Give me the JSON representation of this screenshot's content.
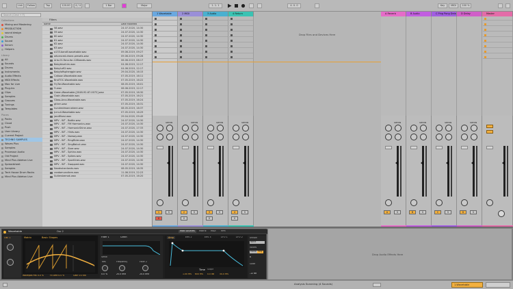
{
  "transport": {
    "link_label": "Link",
    "follow_label": "Follow",
    "tap_label": "Tap",
    "tempo": "120.00",
    "time_sig": "4 / 4",
    "bar_label": "1 Bar",
    "key_label": "Major",
    "position": "1. 1. 1",
    "loop_len": "4. 0. 0",
    "cpu": "CPU",
    "key_sel": "Key",
    "midi_sel": "MIDI",
    "zoom": "100 %"
  },
  "browser": {
    "search_placeholder": "Search (Cmd + F)",
    "places_heading": "Collections",
    "places": [
      {
        "label": "Mixing and Mastering",
        "color": "#e04b3a"
      },
      {
        "label": "PRODUCTION",
        "color": "#f08c28"
      },
      {
        "label": "sound design",
        "color": "#e2c935"
      },
      {
        "label": "Drums",
        "color": "#4cb34c"
      },
      {
        "label": "Sound",
        "color": "#3aa0d8"
      },
      {
        "label": "Serum",
        "color": "#8a5cd0"
      },
      {
        "label": "Helpers",
        "color": "#9a9a9a"
      }
    ],
    "library_heading": "Library",
    "library": [
      "All",
      "Sounds",
      "Drums",
      "Instruments",
      "Audio Effects",
      "MIDI Effects",
      "Max for Live",
      "Plug-Ins",
      "Clips",
      "Samples",
      "Grooves",
      "Tunings",
      "Templates"
    ],
    "places2_heading": "Places",
    "places2": [
      "Packs",
      "Cloud",
      "Push",
      "User Library",
      "Current Project",
      "TECHNO SAMPLES",
      "Waves Plus",
      "Samples",
      "Processor Audio",
      "Old Project",
      "Mind Plus Ableton Live",
      "Spreadsheet",
      "Samples",
      "Tech House Drum Racks",
      "Mind Plus Ableton Live"
    ],
    "selected_place": "TECHNO SAMPLES",
    "filter_label": "Filters",
    "col_name": "Name",
    "col_date": "Date Modified",
    "files": [
      {
        "name": "58.wav",
        "date": "24.07.2020, 14:30"
      },
      {
        "name": "59.wav",
        "date": "24.07.2020, 14:30"
      },
      {
        "name": "60.wav",
        "date": "24.07.2020, 14:30"
      },
      {
        "name": "61.wav",
        "date": "24.07.2020, 14:30"
      },
      {
        "name": "62.wav",
        "date": "24.07.2020, 14:30"
      },
      {
        "name": "63.wav",
        "date": "24.07.2020, 14:30"
      },
      {
        "name": "a133-bandf-wavetable.wav",
        "date": "09.06.2019, 09:27"
      },
      {
        "name": "advanced-drone-presets.wav",
        "date": "09.06.2019, 09:28"
      },
      {
        "name": "Aria-01-Tona-for-128bands.wav",
        "date": "06.06.2019, 08:17"
      },
      {
        "name": "Babybluehim.wav",
        "date": "04.06.2019, 12:17"
      },
      {
        "name": "BabyLofi2.wav",
        "date": "04.06.2019, 12:17"
      },
      {
        "name": "Babylofispherggie.wav",
        "date": "29.04.2020, 16:15"
      },
      {
        "name": "Caltoon-Wavetable.wav",
        "date": "07.05.2019, 16:11"
      },
      {
        "name": "BrstTOC-Wavetable.wav",
        "date": "07.05.2019, 16:22"
      },
      {
        "name": "FryTwi-Wavetable.wav",
        "date": "08.05.2019, 16:01"
      },
      {
        "name": "Fr.wav",
        "date": "06.06.2019, 12:17"
      },
      {
        "name": "Green-Wavetable-[2048-92-67-0072].wav",
        "date": "07.05.2019, 16:30"
      },
      {
        "name": "Grain-Wavetable.wav",
        "date": "07.05.2019, 16:21"
      },
      {
        "name": "Glass-Arco-Wavetable.wav",
        "date": "07.05.2019, 16:24"
      },
      {
        "name": "gthrm.wav",
        "date": "07.05.2019, 16:31"
      },
      {
        "name": "hundredmannahere.wav",
        "date": "08.05.2019, 16:37"
      },
      {
        "name": "Jcrnull-Wavetable.wav",
        "date": "07.05.2019, 16:29"
      },
      {
        "name": "jandMarsi.wav",
        "date": "29.04.2020, 09:49"
      },
      {
        "name": "MPV - WT - Bottle.wav",
        "date": "24.07.2020, 14:30"
      },
      {
        "name": "MPV - WT - FM Harmonics.wav",
        "date": "24.07.2020, 14:30"
      },
      {
        "name": "MPV - WT - HarmonicShine.wav",
        "date": "24.07.2020, 17:33"
      },
      {
        "name": "MPV - WT - Hints.wav",
        "date": "24.07.2020, 14:30"
      },
      {
        "name": "MPV - WT - Norway.wav",
        "date": "24.07.2020, 14:30"
      },
      {
        "name": "MPV - WT - RingRider.wav",
        "date": "24.07.2020, 14:30"
      },
      {
        "name": "MPV - WT - SingBalcut.wav",
        "date": "24.07.2020, 14:30"
      },
      {
        "name": "MPV - WT - Sixer.wav",
        "date": "24.07.2020, 14:30"
      },
      {
        "name": "MPV - WT - Sphinx.wav",
        "date": "24.07.2020, 14:30"
      },
      {
        "name": "MPV - WT - Spikes.wav",
        "date": "24.07.2020, 14:30"
      },
      {
        "name": "MPV - WT - Sportlines.wav",
        "date": "24.07.2020, 14:30"
      },
      {
        "name": "MPV - WT - Swapped.wav",
        "date": "24.07.2020, 14:30"
      },
      {
        "name": "Narakshanlands.wav",
        "date": "08.05.2019, 16:35"
      },
      {
        "name": "randomunvitem.wav",
        "date": "11.06.2019, 22:23"
      },
      {
        "name": "Sutlerskemak.wav",
        "date": "07.05.2019, 16:20"
      }
    ]
  },
  "session": {
    "tracks": [
      {
        "name": "1 Wavetable",
        "color": "#6aa8e0",
        "bg": "#cbcbcb"
      },
      {
        "name": "2 MIDI",
        "color": "#9a8fd8",
        "bg": "#bababa"
      },
      {
        "name": "3 Audio",
        "color": "#4ab0d0",
        "bg": "#bababa"
      },
      {
        "name": "4 Return",
        "color": "#3ac3b3",
        "bg": "#bababa"
      }
    ],
    "drop_label": "Drop Files and Devices Here",
    "returns": [
      {
        "name": "A Reverb",
        "color": "#e56cc8"
      },
      {
        "name": "B Audio",
        "color": "#c15ee0"
      },
      {
        "name": "C Ping Pong Delay",
        "color": "#a05ee0"
      },
      {
        "name": "D Delay",
        "color": "#d05ec8"
      }
    ],
    "master": {
      "name": "Master",
      "color": "#e36ca8"
    },
    "sends_label": "Sends",
    "vol_db": "-inf",
    "track_numbers": [
      "1",
      "2",
      "3",
      "4"
    ],
    "return_letters": [
      "A",
      "B",
      "C",
      "D"
    ],
    "solo_label": "S",
    "arm_label": "0"
  },
  "device": {
    "title": "Wavetable",
    "osc1_label": "Osc 1",
    "osc2_label": "Osc 2",
    "matrix_label": "Matrix",
    "mode_label": "Basic Shapes",
    "sub_label": "Sub",
    "filter_label": "Filter",
    "filter_type": "Clean",
    "filter1": "Filter 1",
    "filter2": "Filter 2",
    "serial_label": "Serial",
    "freq_label": "Frequency",
    "freq_value": "20.0 kHz",
    "res_label": "Res",
    "res_value": "0.0 %",
    "tabs": [
      "Mod Sources",
      "Matrix",
      "MIDI",
      "MPE"
    ],
    "amp_label": "Amp",
    "env2_label": "Env 2",
    "env3_label": "Env 3",
    "lfo1_label": "LFO 1",
    "lfo2_label": "LFO 2",
    "time_label": "Time",
    "slope_label": "Slope",
    "env_vals": [
      "1.00 ms",
      "600 ms",
      "0.0 dB",
      "50.0 ms"
    ],
    "bottom_vals": [
      "Wavepos Pos 0.0 %",
      "Fx Amt 0.0 %",
      "Gain 0.0 dB"
    ],
    "unison_label": "Unison",
    "unison_value": "None",
    "voices_label": "Voices",
    "mono_label": "Mono",
    "poly_label": "Poly",
    "poly_value": "8",
    "glide_label": "Glide",
    "volume_value": "-12 dB",
    "drop_label": "Drop Audio Effects Here"
  },
  "status": {
    "message": "Analysis Scanning (4 Sounds)",
    "right_label": "1-Wavetable"
  }
}
